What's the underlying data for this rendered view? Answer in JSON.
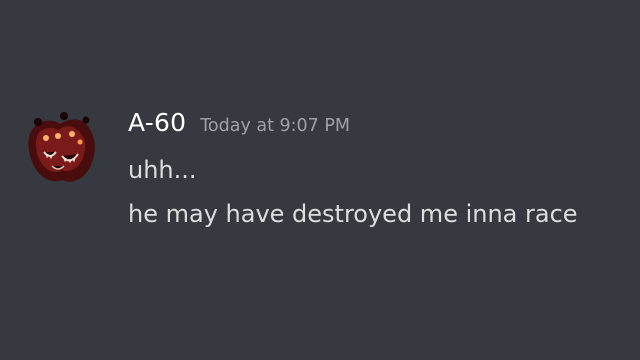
{
  "message": {
    "author": "A-60",
    "timestamp": "Today at 9:07 PM",
    "avatar_icon": "a60-monster-face-icon",
    "lines": [
      "uhh...",
      "he may have destroyed me inna race"
    ]
  },
  "colors": {
    "background": "#36393f",
    "author": "#ffffff",
    "timestamp": "#9ea1a6",
    "text": "#dcddde",
    "avatar_red": "#6b1414"
  }
}
